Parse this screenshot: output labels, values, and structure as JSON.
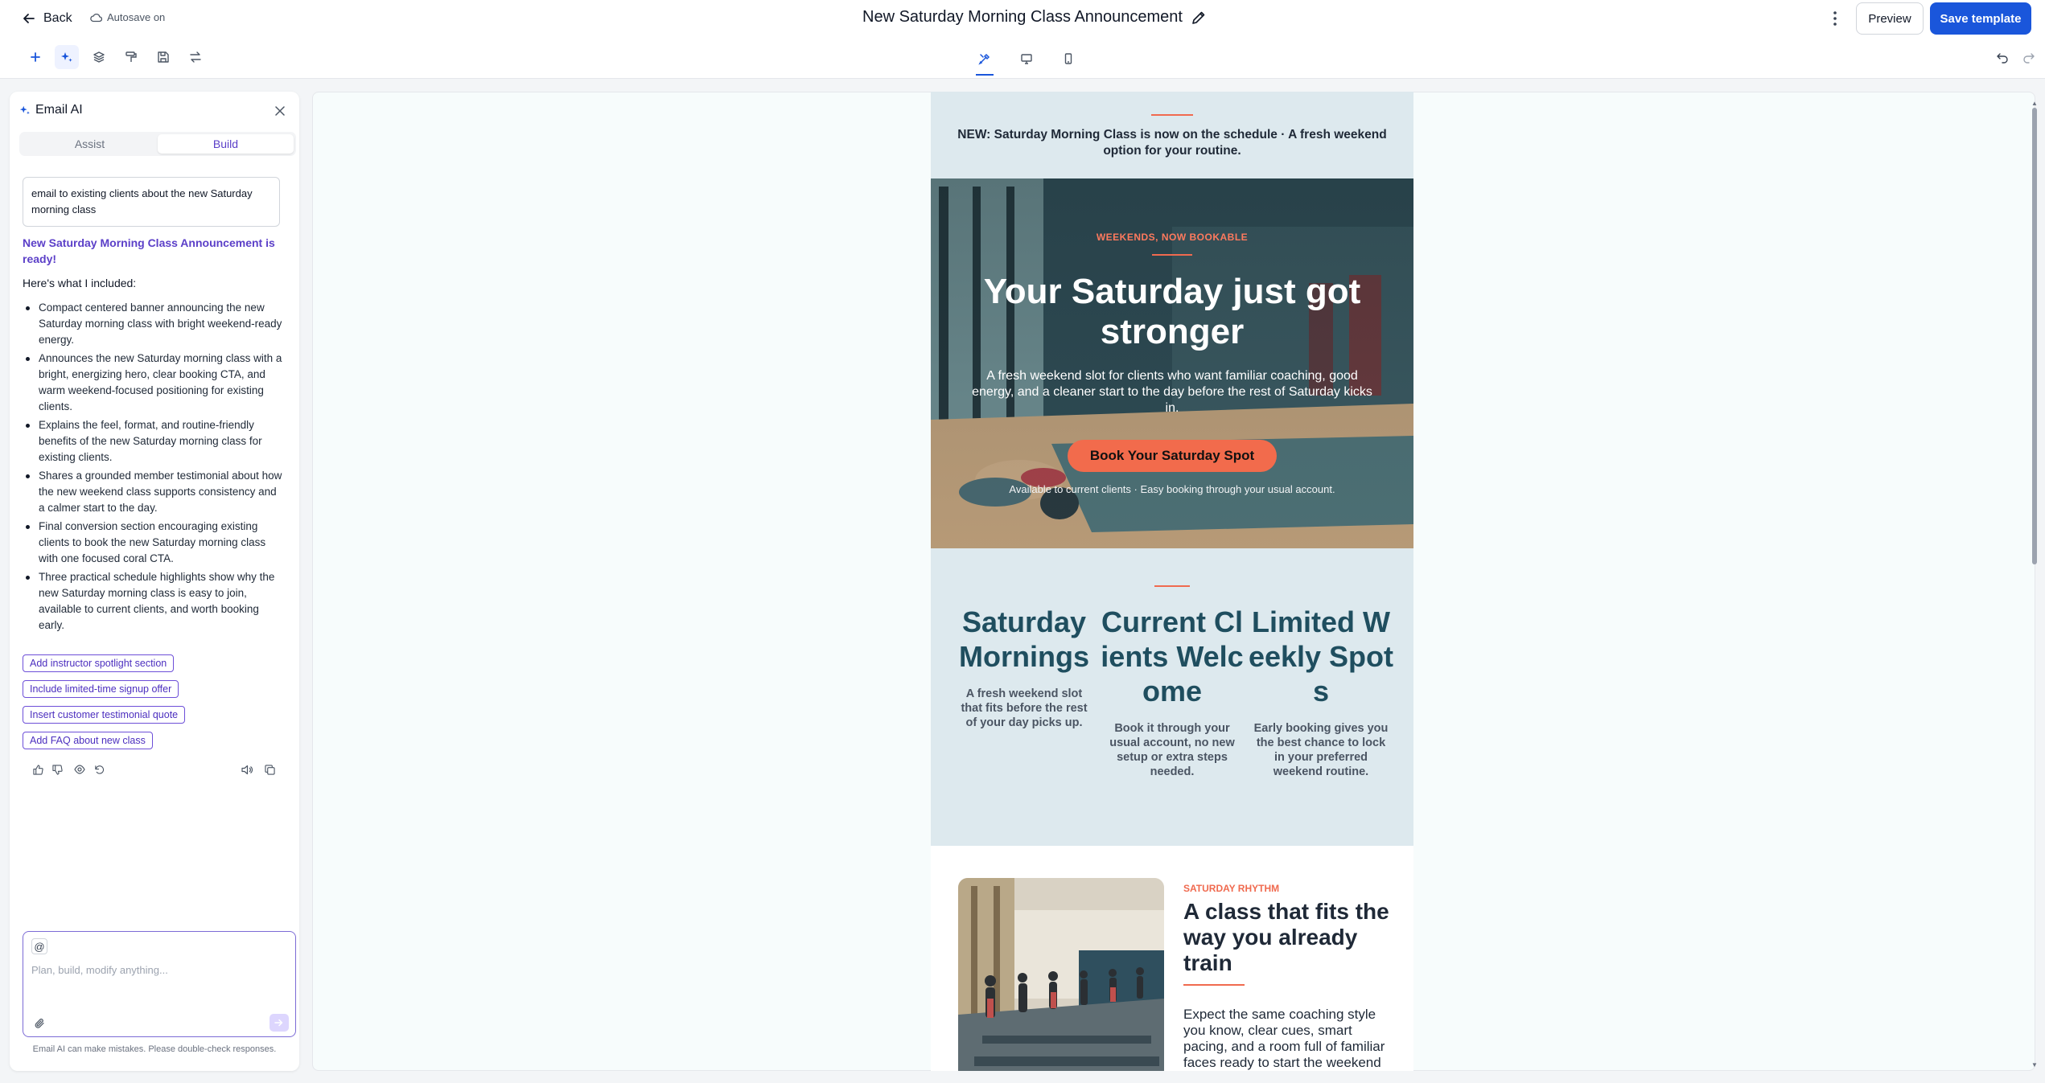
{
  "topbar": {
    "back_label": "Back",
    "autosave_label": "Autosave on",
    "document_title": "New Saturday Morning Class Announcement",
    "preview_label": "Preview",
    "save_label": "Save template"
  },
  "toolbar": {
    "left_tools": [
      "plus-icon",
      "sparkle-icon",
      "layers-icon",
      "paint-roller-icon",
      "save-icon",
      "swap-icon"
    ],
    "view_modes": [
      "design-icon",
      "desktop-icon",
      "mobile-icon"
    ],
    "active_view": "design",
    "history": [
      "undo-icon",
      "redo-icon"
    ]
  },
  "ai_panel": {
    "title": "Email AI",
    "tabs": [
      {
        "label": "Assist",
        "active": false
      },
      {
        "label": "Build",
        "active": true
      }
    ],
    "user_message": "email to existing clients about the new Saturday morning class",
    "ready_message": "New Saturday Morning Class Announcement is ready!",
    "intro": "Here's what I included:",
    "included": [
      "Compact centered banner announcing the new Saturday morning class with bright weekend-ready energy.",
      "Announces the new Saturday morning class with a bright, energizing hero, clear booking CTA, and warm weekend-focused positioning for existing clients.",
      "Explains the feel, format, and routine-friendly benefits of the new Saturday morning class for existing clients.",
      "Shares a grounded member testimonial about how the new weekend class supports consistency and a calmer start to the day.",
      "Final conversion section encouraging existing clients to book the new Saturday morning class with one focused coral CTA.",
      "Three practical schedule highlights show why the new Saturday morning class is easy to join, available to current clients, and worth booking early."
    ],
    "suggestions": [
      "Add instructor spotlight section",
      "Include limited-time signup offer",
      "Insert customer testimonial quote",
      "Add FAQ about new class"
    ],
    "composer_placeholder": "Plan, build, modify anything...",
    "composer_at": "@",
    "disclaimer": "Email AI can make mistakes. Please double-check responses."
  },
  "email": {
    "banner_text": "NEW: Saturday Morning Class is now on the schedule · A fresh weekend option for your routine.",
    "hero": {
      "eyebrow": "WEEKENDS, NOW BOOKABLE",
      "title": "Your Saturday just got stronger",
      "body": "A fresh weekend slot for clients who want familiar coaching, good energy, and a cleaner start to the day before the rest of Saturday kicks in.",
      "cta": "Book Your Saturday Spot",
      "note": "Available to current clients · Easy booking through your usual account."
    },
    "highlights": [
      {
        "title": "Saturday Mornings",
        "body": "A fresh weekend slot that fits before the rest of your day picks up."
      },
      {
        "title": "Current Clients Welcome",
        "body": "Book it through your usual account, no new setup or extra steps needed."
      },
      {
        "title": "Limited Weekly Spots",
        "body": "Early booking gives you the best chance to lock in your preferred weekend routine."
      }
    ],
    "feature": {
      "eyebrow": "SATURDAY RHYTHM",
      "title": "A class that fits the way you already train",
      "body": "Expect the same coaching style you know, clear cues, smart pacing, and a room full of familiar faces ready to start the weekend"
    }
  },
  "colors": {
    "primary": "#1a56db",
    "ai_accent": "#5b3fc8",
    "coral": "#f26b4c",
    "banner_bg": "#dde9ee",
    "highlight_title": "#1f4e5f"
  }
}
